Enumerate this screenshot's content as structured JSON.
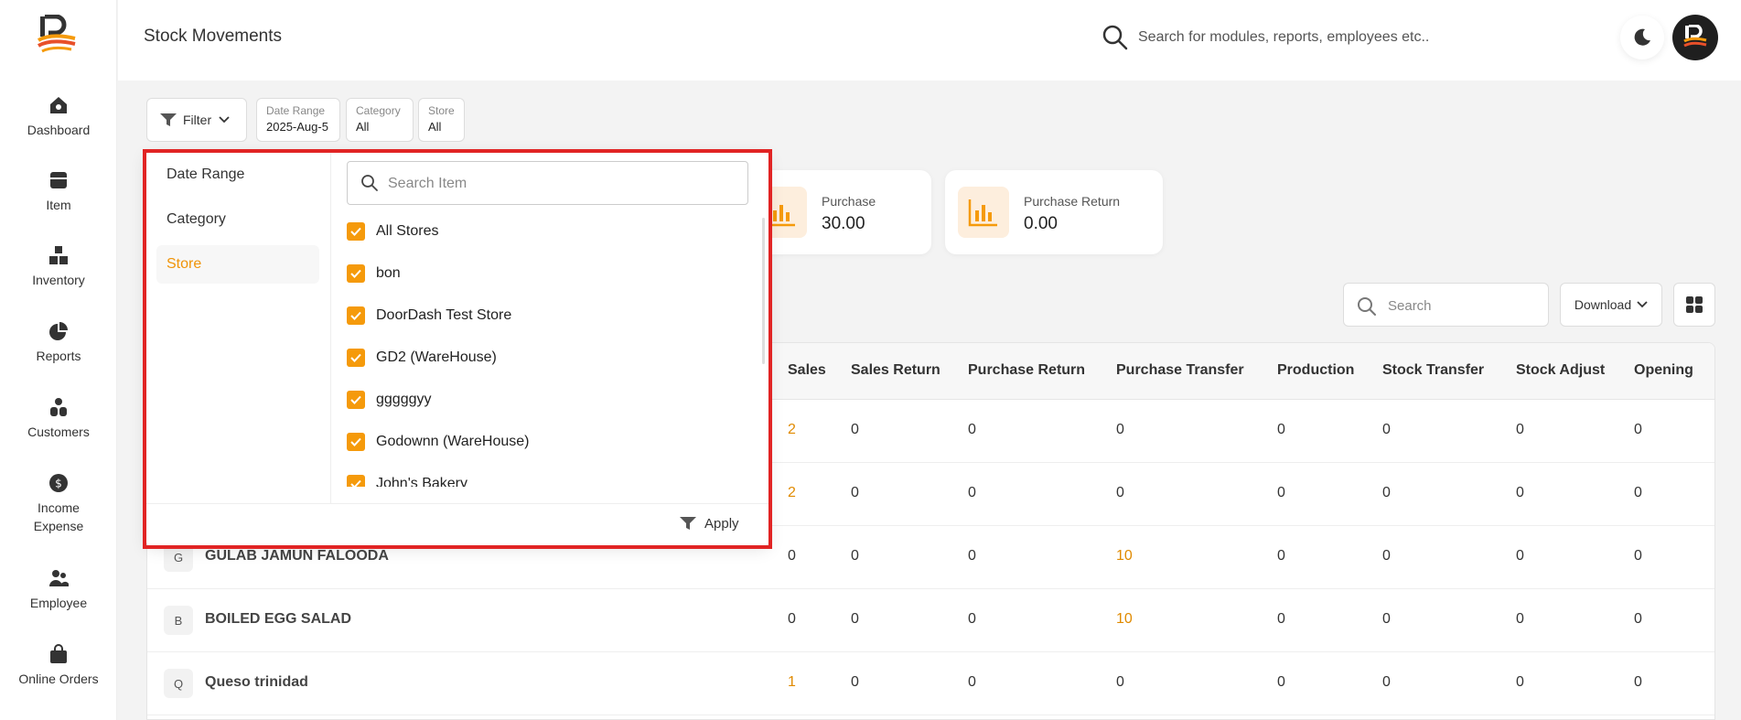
{
  "sidebar": {
    "items": [
      {
        "label": "Dashboard",
        "icon": "home-icon"
      },
      {
        "label": "Item",
        "icon": "item-icon"
      },
      {
        "label": "Inventory",
        "icon": "boxes-icon"
      },
      {
        "label": "Reports",
        "icon": "pie-chart-icon"
      },
      {
        "label": "Customers",
        "icon": "users-icon"
      },
      {
        "label": "Income\nExpense",
        "icon": "dollar-icon"
      },
      {
        "label": "Employee",
        "icon": "employee-icon"
      },
      {
        "label": "Online Orders",
        "icon": "shopping-bag-icon"
      }
    ]
  },
  "header": {
    "title": "Stock Movements",
    "search_placeholder": "Search for modules, reports, employees etc.."
  },
  "filters": {
    "filter_label": "Filter",
    "chips": [
      {
        "key": "Date Range",
        "value": "2025-Aug-5"
      },
      {
        "key": "Category",
        "value": "All"
      },
      {
        "key": "Store",
        "value": "All"
      }
    ]
  },
  "stats": [
    {
      "label": "Purchase",
      "value": "30.00"
    },
    {
      "label": "Purchase Return",
      "value": "0.00"
    }
  ],
  "table_tools": {
    "search_placeholder": "Search",
    "download_label": "Download"
  },
  "table": {
    "columns": [
      "Sales",
      "Sales Return",
      "Purchase Return",
      "Purchase Transfer",
      "Production",
      "Stock Transfer",
      "Stock Adjust",
      "Opening"
    ],
    "rows": [
      {
        "badge": "",
        "name": "",
        "cells": [
          "2",
          "0",
          "0",
          "0",
          "0",
          "0",
          "0",
          "0"
        ]
      },
      {
        "badge": "",
        "name": "",
        "cells": [
          "2",
          "0",
          "0",
          "0",
          "0",
          "0",
          "0",
          "0"
        ]
      },
      {
        "badge": "G",
        "name": "GULAB JAMUN FALOODA",
        "cells": [
          "0",
          "0",
          "0",
          "10",
          "0",
          "0",
          "0",
          "0"
        ]
      },
      {
        "badge": "B",
        "name": "BOILED EGG SALAD",
        "cells": [
          "0",
          "0",
          "0",
          "10",
          "0",
          "0",
          "0",
          "0"
        ]
      },
      {
        "badge": "Q",
        "name": "Queso trinidad",
        "cells": [
          "1",
          "0",
          "0",
          "0",
          "0",
          "0",
          "0",
          "0"
        ]
      }
    ]
  },
  "dropdown": {
    "categories": [
      "Date Range",
      "Category",
      "Store"
    ],
    "active_category": "Store",
    "search_placeholder": "Search Item",
    "options": [
      "All Stores",
      "bon",
      "DoorDash Test Store",
      "GD2 (WareHouse)",
      "gggggyy",
      "Godownn (WareHouse)",
      "John's Bakery"
    ],
    "apply_label": "Apply"
  },
  "colors": {
    "accent": "#f59a0b",
    "highlight": "#e12424"
  }
}
